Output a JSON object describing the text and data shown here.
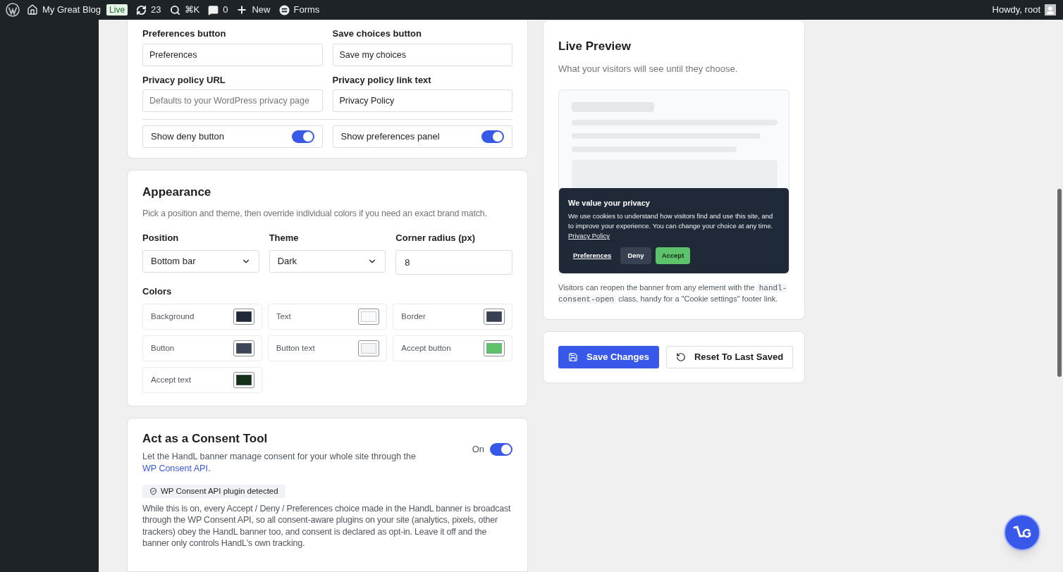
{
  "admin_bar": {
    "items": [
      {
        "kind": "site",
        "label": "My Great Blog",
        "badge": "Live"
      },
      {
        "kind": "updates",
        "label": "23"
      },
      {
        "kind": "search",
        "label": "⌘K"
      },
      {
        "kind": "comments",
        "label": "0"
      },
      {
        "kind": "new",
        "label": "New"
      },
      {
        "kind": "forms",
        "label": "Forms"
      }
    ],
    "greeting": "Howdy, root"
  },
  "text_settings": {
    "fields": [
      {
        "label": "Preferences button",
        "value": "Preferences"
      },
      {
        "label": "Save choices button",
        "value": "Save my choices"
      },
      {
        "label": "Privacy policy URL",
        "placeholder": "Defaults to your WordPress privacy page"
      },
      {
        "label": "Privacy policy link text",
        "value": "Privacy Policy"
      }
    ],
    "toggles": [
      {
        "label": "Show deny button",
        "on": true
      },
      {
        "label": "Show preferences panel",
        "on": true
      }
    ]
  },
  "appearance": {
    "title": "Appearance",
    "description": "Pick a position and theme, then override individual colors if you need an exact brand match.",
    "controls": [
      {
        "kind": "select",
        "label": "Position",
        "value": "Bottom bar"
      },
      {
        "kind": "select",
        "label": "Theme",
        "value": "Dark"
      },
      {
        "kind": "input",
        "label": "Corner radius (px)",
        "value": "8"
      }
    ],
    "colors_label": "Colors",
    "colors": [
      {
        "label": "Background",
        "color": "#1f2937"
      },
      {
        "label": "Text",
        "color": "#f9fafb"
      },
      {
        "label": "Border",
        "color": "#374151"
      },
      {
        "label": "Button",
        "color": "#3d4659"
      },
      {
        "label": "Button text",
        "color": "#f3f4f6"
      },
      {
        "label": "Accept button",
        "color": "#5cc26b"
      },
      {
        "label": "Accept text",
        "color": "#14301a"
      }
    ]
  },
  "consent_tool": {
    "title": "Act as a Consent Tool",
    "description": "Let the HandL banner manage consent for your whole site through the",
    "link": "WP Consent API",
    "description_end": ".",
    "toggle_label": "On",
    "on": true,
    "badge": "WP Consent API plugin detected",
    "body": "While this is on, every Accept / Deny / Preferences choice made in the HandL banner is broadcast through the WP Consent API, so all consent-aware plugins on your site (analytics, pixels, other trackers) obey the HandL banner too, and consent is declared as opt-in. Leave it off and the banner only controls HandL's own tracking."
  },
  "preview": {
    "title": "Live Preview",
    "subtitle": "What your visitors will see until they choose.",
    "banner": {
      "title": "We value your privacy",
      "text": "We use cookies to understand how visitors find and use this site, and to improve your experience. You can change your choice at any time.",
      "link": "Privacy Policy",
      "buttons": [
        {
          "kind": "link",
          "label": "Preferences"
        },
        {
          "kind": "deny",
          "label": "Deny"
        },
        {
          "kind": "accept",
          "label": "Accept"
        }
      ]
    },
    "note_start": "Visitors can reopen the banner from any element with the",
    "note_code": "handl-consent-open",
    "note_end": "class, handy for a \"Cookie settings\" footer link."
  },
  "actions": [
    {
      "kind": "primary",
      "label": "Save Changes"
    },
    {
      "kind": "secondary",
      "label": "Reset To Last Saved"
    }
  ]
}
